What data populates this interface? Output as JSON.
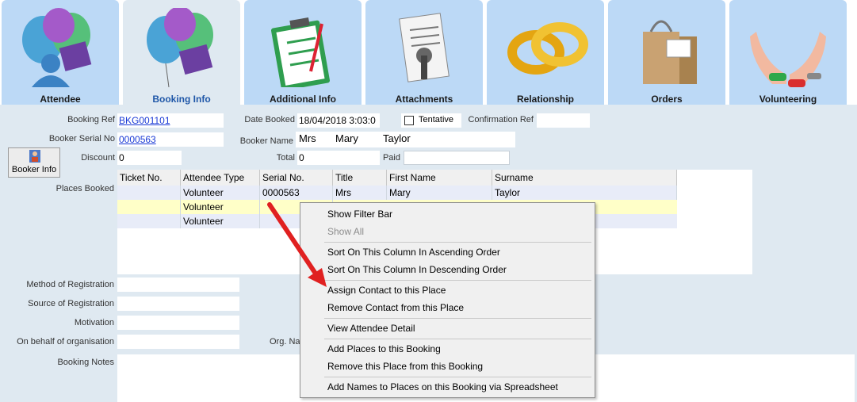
{
  "tabs": [
    {
      "label": "Attendee",
      "icon": "attendee-balloons-icon"
    },
    {
      "label": "Booking Info",
      "icon": "booking-balloons-icon",
      "active": true
    },
    {
      "label": "Additional Info",
      "icon": "clipboard-icon"
    },
    {
      "label": "Attachments",
      "icon": "paper-clip-document-icon"
    },
    {
      "label": "Relationship",
      "icon": "rings-icon"
    },
    {
      "label": "Orders",
      "icon": "shopping-bag-icon"
    },
    {
      "label": "Volunteering",
      "icon": "helping-hands-icon"
    }
  ],
  "form": {
    "booking_ref_label": "Booking Ref",
    "booking_ref": "BKG001101",
    "date_booked_label": "Date Booked",
    "date_booked": "18/04/2018 3:03:0",
    "tentative_label": "Tentative",
    "confirmation_ref_label": "Confirmation Ref",
    "confirmation_ref": "",
    "booker_serial_label": "Booker Serial No",
    "booker_serial": "0000563",
    "booker_name_label": "Booker Name",
    "booker_title": "Mrs",
    "booker_first": "Mary",
    "booker_surname": "Taylor",
    "discount_label": "Discount",
    "discount": "0",
    "total_label": "Total",
    "total": "0",
    "paid_label": "Paid",
    "paid": "",
    "booker_info_button": "Booker Info",
    "places_booked_label": "Places Booked",
    "method_label": "Method of Registration",
    "source_label": "Source of Registration",
    "motivation_label": "Motivation",
    "on_behalf_label": "On behalf of organisation",
    "org_name_label": "Org. Na",
    "booking_notes_label": "Booking Notes"
  },
  "grid": {
    "columns": [
      "Ticket No.",
      "Attendee Type",
      "Serial No.",
      "Title",
      "First Name",
      "Surname"
    ],
    "rows": [
      [
        "",
        "Volunteer",
        "0000563",
        "Mrs",
        "Mary",
        "Taylor"
      ],
      [
        "",
        "Volunteer",
        "",
        "",
        "",
        ""
      ],
      [
        "",
        "Volunteer",
        "",
        "",
        "",
        ""
      ]
    ]
  },
  "context_menu": {
    "items": [
      "Show Filter Bar",
      "Show All",
      "Sort On This Column In Ascending Order",
      "Sort On This Column In Descending Order",
      "Assign Contact to this Place",
      "Remove Contact from this Place",
      "View Attendee Detail",
      "Add Places to this Booking",
      "Remove this Place from this Booking",
      "Add Names to Places on this Booking via Spreadsheet"
    ]
  },
  "colors": {
    "tab": "#bcd9f6",
    "active_tab": "#dfe9f1",
    "highlight_row": "#ffffc8",
    "annotation_arrow": "#e02020"
  }
}
